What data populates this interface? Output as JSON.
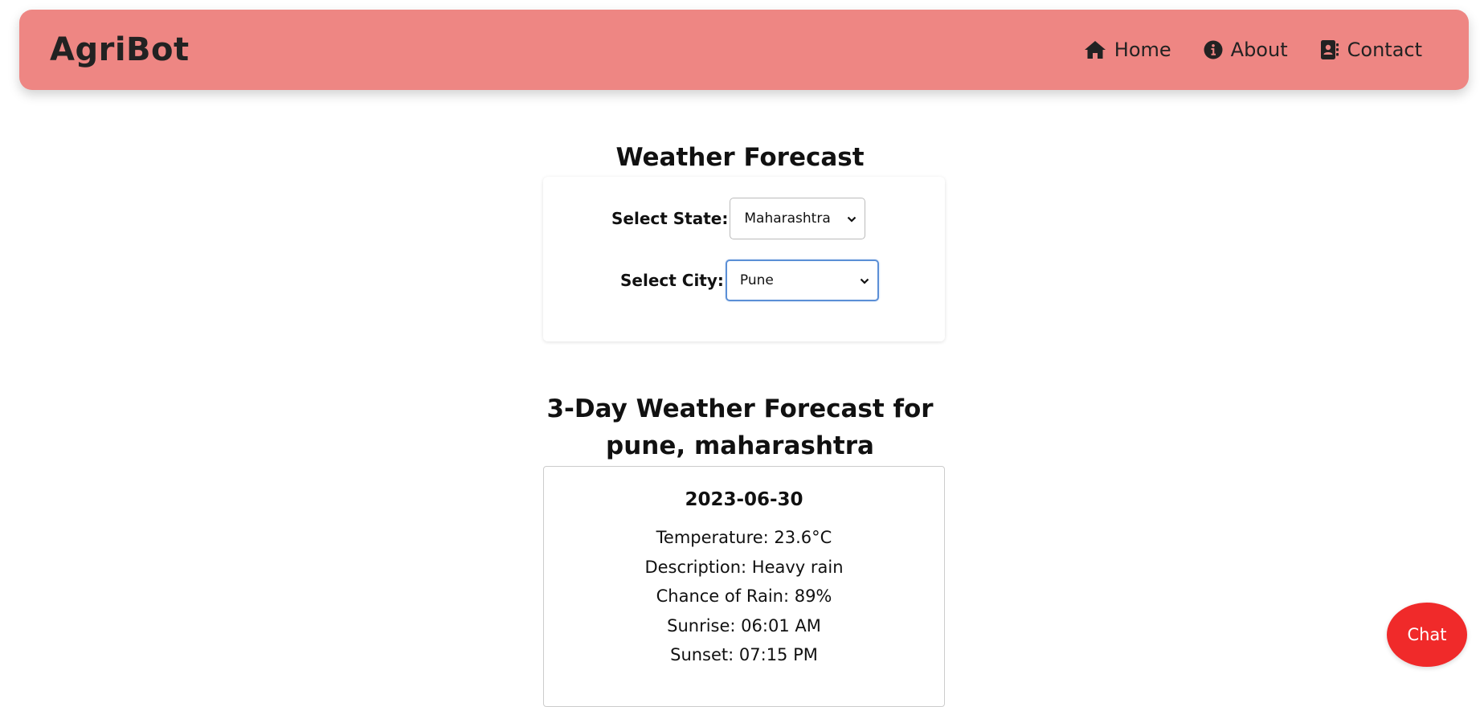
{
  "navbar": {
    "brand": "AgriBot",
    "background_color": "#ee8683",
    "links": [
      {
        "label": "Home",
        "icon": "home-icon"
      },
      {
        "label": "About",
        "icon": "info-circle-icon"
      },
      {
        "label": "Contact",
        "icon": "address-book-icon"
      }
    ]
  },
  "weather": {
    "title": "Weather Forecast",
    "state_label": "Select State:",
    "state_value": "Maharashtra",
    "city_label": "Select City:",
    "city_value": "Pune"
  },
  "forecast": {
    "title_line1": "3-Day Weather Forecast for",
    "title_line2": "pune, maharashtra",
    "days": [
      {
        "date": "2023-06-30",
        "temperature": "Temperature: 23.6°C",
        "description": "Description: Heavy rain",
        "rain_chance": "Chance of Rain: 89%",
        "sunrise": "Sunrise: 06:01 AM",
        "sunset": "Sunset: 07:15 PM"
      }
    ]
  },
  "chat": {
    "label": "Chat",
    "color": "#f02a2a"
  }
}
